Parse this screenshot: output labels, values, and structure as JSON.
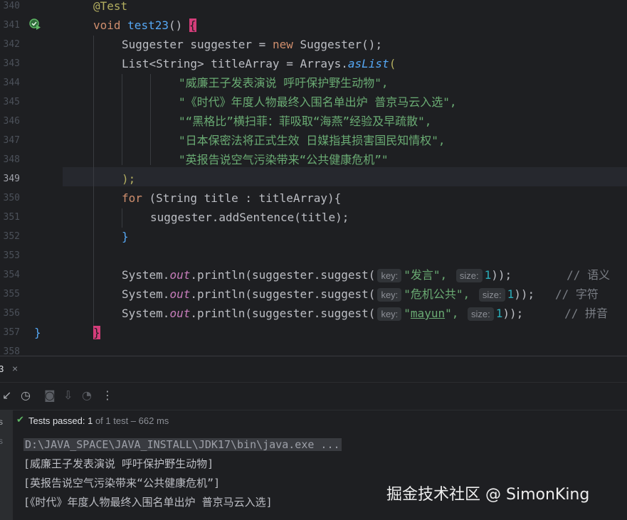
{
  "editor": {
    "line_numbers": [
      "340",
      "341",
      "342",
      "343",
      "344",
      "345",
      "346",
      "347",
      "348",
      "349",
      "350",
      "351",
      "352",
      "353",
      "354",
      "355",
      "356",
      "357",
      "358"
    ],
    "active_line": "349",
    "code": {
      "annotation": "@Test",
      "void": "void",
      "method_name": "test23",
      "parens": "() ",
      "open_brace": "{",
      "l342_type": "Suggester",
      "l342_var": " suggester = ",
      "l342_new": "new",
      "l342_rest": " Suggester();",
      "l343_a": "List<String> titleArray = Arrays.",
      "l343_m": "asList",
      "l343_b": "(",
      "s1": "\"威廉王子发表演说 呼吁保护野生动物\",",
      "s2": "\"《时代》年度人物最终入围名单出炉 普京马云入选\",",
      "s3": "\"“黑格比”横扫菲：菲吸取“海燕”经验及早疏散\",",
      "s4": "\"日本保密法将正式生效 日媒指其损害国民知情权\",",
      "s5": "\"英报告说空气污染带来“公共健康危机”\"",
      "close_paren": ");",
      "for_kw": "for",
      "for_rest": " (String title : titleArray){",
      "add_line": "suggester.addSentence(title);",
      "close_brace_inner": "}",
      "sys": "System.",
      "out": "out",
      "println": ".println(suggester.suggest(",
      "hint_key": "key:",
      "hint_size": "size:",
      "q1": "\"发言\",",
      "q2": "\"危机公共\",",
      "q3a": "\"",
      "q3b": "mayun",
      "q3c": "\",",
      "one": "1",
      "tail": "));",
      "c1": "// 语义",
      "c2": "// 字符",
      "c3": "// 拼音",
      "close_brace_method": "}",
      "close_brace_class": "}"
    }
  },
  "panel": {
    "tab_label": "3",
    "tab_close": "×",
    "status_passed": "Tests passed: 1",
    "status_detail": " of 1 test – 662 ms",
    "side_label": "s",
    "console_lines": [
      "D:\\JAVA_SPACE\\JAVA_INSTALL\\JDK17\\bin\\java.exe ...",
      "[威廉王子发表演说 呼吁保护野生动物]",
      "[英报告说空气污染带来“公共健康危机”]",
      "[《时代》年度人物最终入围名单出炉 普京马云入选]"
    ]
  },
  "watermark": "掘金技术社区 @ SimonKing",
  "colors": {
    "background": "#1e1f22",
    "keyword": "#cf8e6d",
    "function": "#56a8f5",
    "string": "#6aab73",
    "number": "#2aacb8",
    "static_field": "#c77dbb",
    "brace_highlight": "#d43d7a",
    "pass_green": "#5fb865"
  },
  "icons": {
    "run_status": "test-passed-gutter-icon",
    "toolbar": [
      "sort-icon",
      "history-icon",
      "camera-icon",
      "export-icon",
      "gauge-icon",
      "more-icon"
    ],
    "status": "check-icon"
  }
}
